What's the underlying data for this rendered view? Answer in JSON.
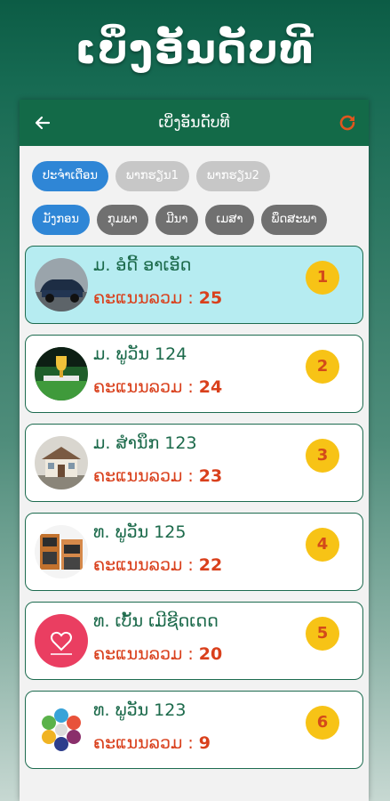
{
  "banner": {
    "title": "ເບິ່ງອັນດັບທີ"
  },
  "appbar": {
    "title": "ເບິ່ງອັນດັບທີ"
  },
  "filters": {
    "row1": [
      {
        "label": "ປະຈຳເດືອນ",
        "state": "active"
      },
      {
        "label": "ພາກຮຽນ1",
        "state": "light"
      },
      {
        "label": "ພາກຮຽນ2",
        "state": "light"
      }
    ],
    "row2": [
      {
        "label": "ມັງກອນ",
        "state": "active"
      },
      {
        "label": "ກຸມພາ",
        "state": "dark"
      },
      {
        "label": "ມີນາ",
        "state": "dark"
      },
      {
        "label": "ເມສາ",
        "state": "dark"
      },
      {
        "label": "ພຶດສະພາ",
        "state": "dark"
      }
    ]
  },
  "score_prefix": "ຄະແນນລວມ : ",
  "rankings": [
    {
      "rank": "1",
      "name": "ມ. ອໍດີ້ ອາເອັດ",
      "score": "25",
      "avatar": "car-photo"
    },
    {
      "rank": "2",
      "name": "ມ. ພູວັນ 124",
      "score": "24",
      "avatar": "trophy-stadium-photo"
    },
    {
      "rank": "3",
      "name": "ມ. ສໍານຶກ 123",
      "score": "23",
      "avatar": "house-photo"
    },
    {
      "rank": "4",
      "name": "ທ. ພູວັນ 125",
      "score": "22",
      "avatar": "shop-photo"
    },
    {
      "rank": "5",
      "name": "ທ. ເບັ້ນ ເມີຊີດເດດ",
      "score": "20",
      "avatar": "heart-logo"
    },
    {
      "rank": "6",
      "name": "ທ. ພູວັນ 123",
      "score": "9",
      "avatar": "hexagon-logo"
    }
  ],
  "colors": {
    "primary": "#136a48",
    "accent": "#2f86d6",
    "score": "#d9401c",
    "badge": "#f7c316",
    "first_card": "#b6ecf1"
  },
  "icons": {
    "back": "arrow-left-icon",
    "refresh": "refresh-icon"
  }
}
